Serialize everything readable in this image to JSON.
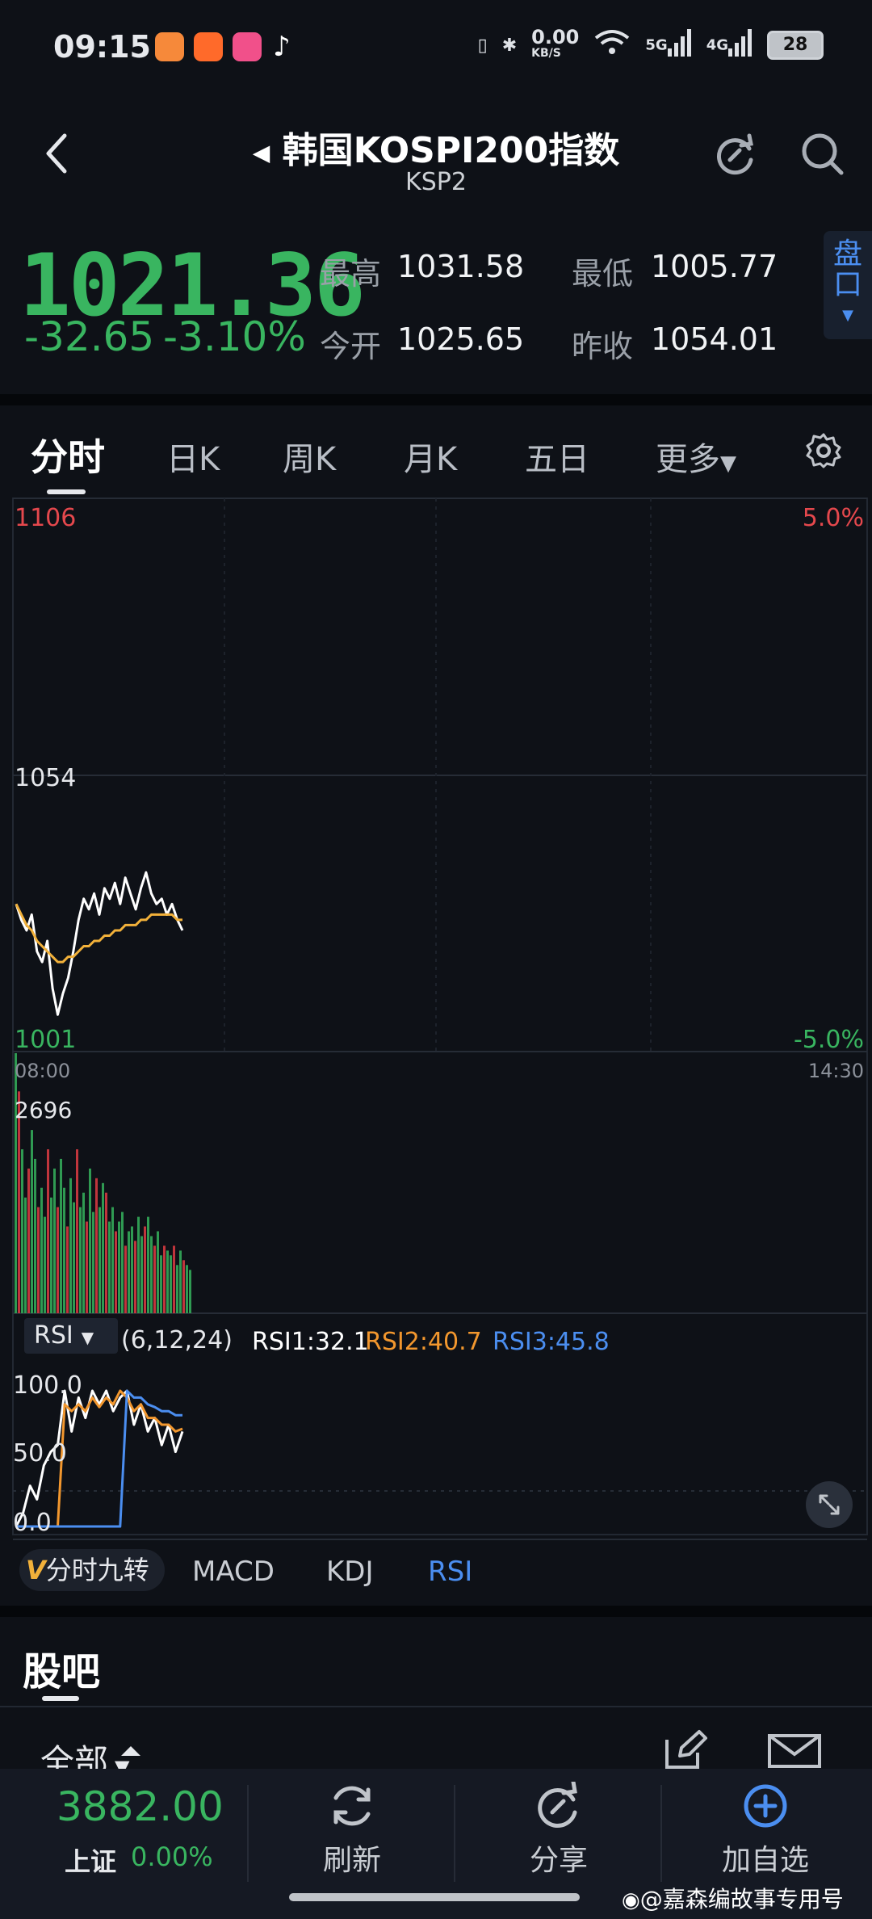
{
  "status_bar": {
    "time": "09:15",
    "net_speed_value": "0.00",
    "net_speed_unit": "KB/S",
    "signal1": "5G",
    "signal2": "4G",
    "battery": "28"
  },
  "header": {
    "title": "韩国KOSPI200指数",
    "code": "KSP2"
  },
  "quote": {
    "price": "1021.36",
    "change": "-32.65",
    "change_pct": "-3.10%",
    "high_label": "最高",
    "high": "1031.58",
    "low_label": "最低",
    "low": "1005.77",
    "open_label": "今开",
    "open": "1025.65",
    "prev_close_label": "昨收",
    "prev_close": "1054.01",
    "pankou_label_1": "盘",
    "pankou_label_2": "口"
  },
  "tabs": [
    "分时",
    "日K",
    "周K",
    "月K",
    "五日",
    "更多"
  ],
  "chart_data": [
    {
      "type": "line",
      "y_labels": {
        "top": "1106",
        "mid": "1054",
        "bottom": "1001"
      },
      "pct_labels": {
        "top": "5.0%",
        "bottom": "-5.0%"
      },
      "x_labels": {
        "start": "08:00",
        "end": "14:30"
      },
      "ylim": [
        1001,
        1106
      ],
      "series": [
        {
          "name": "price",
          "color": "#ffffff",
          "values": [
            1029,
            1026,
            1024,
            1027,
            1020,
            1018,
            1022,
            1013,
            1008,
            1012,
            1015,
            1020,
            1026,
            1030,
            1028,
            1031,
            1027,
            1032,
            1030,
            1033,
            1029,
            1034,
            1031,
            1028,
            1032,
            1035,
            1031,
            1029,
            1030,
            1027,
            1029,
            1026,
            1024
          ]
        },
        {
          "name": "avg",
          "color": "#f2b13a",
          "values": [
            1029,
            1027,
            1025,
            1024,
            1022,
            1021,
            1020,
            1019,
            1018,
            1018,
            1019,
            1019,
            1020,
            1021,
            1021,
            1022,
            1022,
            1023,
            1023,
            1024,
            1024,
            1025,
            1025,
            1025,
            1026,
            1026,
            1027,
            1027,
            1027,
            1027,
            1027,
            1026,
            1026
          ]
        }
      ]
    },
    {
      "type": "bar",
      "max_label": "2696",
      "ylim": [
        0,
        2696
      ],
      "values": [
        2696,
        2300,
        1700,
        1200,
        1500,
        1900,
        1600,
        1100,
        1300,
        1000,
        1700,
        1200,
        1500,
        1100,
        1600,
        1300,
        900,
        1400,
        1150,
        1700,
        1100,
        1250,
        950,
        1500,
        1050,
        1400,
        1100,
        1350,
        1250,
        950,
        1100,
        850,
        950,
        1050,
        700,
        850,
        900,
        750,
        1000,
        800,
        900,
        1000,
        800,
        700,
        850,
        600,
        700,
        650,
        600,
        700,
        500,
        650,
        550,
        500,
        450
      ]
    },
    {
      "type": "line",
      "indicator": "RSI",
      "params": "(6,12,24)",
      "rsi1": "RSI1:32.1",
      "rsi2": "RSI2:40.7",
      "rsi3": "RSI3:45.8",
      "y_labels": [
        "100.0",
        "50.0",
        "0.0"
      ],
      "ylim": [
        0,
        100
      ],
      "series": [
        {
          "name": "RSI1",
          "color": "#ffffff",
          "values": [
            0,
            10,
            30,
            20,
            45,
            55,
            60,
            100,
            70,
            95,
            80,
            100,
            90,
            100,
            85,
            95,
            100,
            75,
            90,
            70,
            80,
            60,
            75,
            55,
            70
          ]
        },
        {
          "name": "RSI2",
          "color": "#f2972e",
          "values": [
            0,
            0,
            0,
            0,
            0,
            0,
            0,
            90,
            85,
            90,
            85,
            95,
            88,
            95,
            90,
            100,
            95,
            85,
            90,
            80,
            80,
            75,
            75,
            70,
            72
          ]
        },
        {
          "name": "RSI3",
          "color": "#4b8ef0",
          "values": [
            0,
            0,
            0,
            0,
            0,
            0,
            0,
            0,
            0,
            0,
            0,
            0,
            0,
            0,
            0,
            0,
            100,
            95,
            95,
            90,
            88,
            85,
            85,
            82,
            82
          ]
        }
      ]
    }
  ],
  "indicator_tabs": [
    "分时九转",
    "MACD",
    "KDJ",
    "RSI"
  ],
  "guba": {
    "title": "股吧",
    "filter": "全部"
  },
  "bottom": {
    "index_value": "3882.00",
    "index_name": "上证",
    "index_pct": "0.00%",
    "refresh": "刷新",
    "share": "分享",
    "add": "加自选"
  },
  "watermark": "@嘉森编故事专用号",
  "colors": {
    "green": "#39b560",
    "red": "#e5484d",
    "blue": "#4b8ef0",
    "bg": "#0e1117"
  }
}
